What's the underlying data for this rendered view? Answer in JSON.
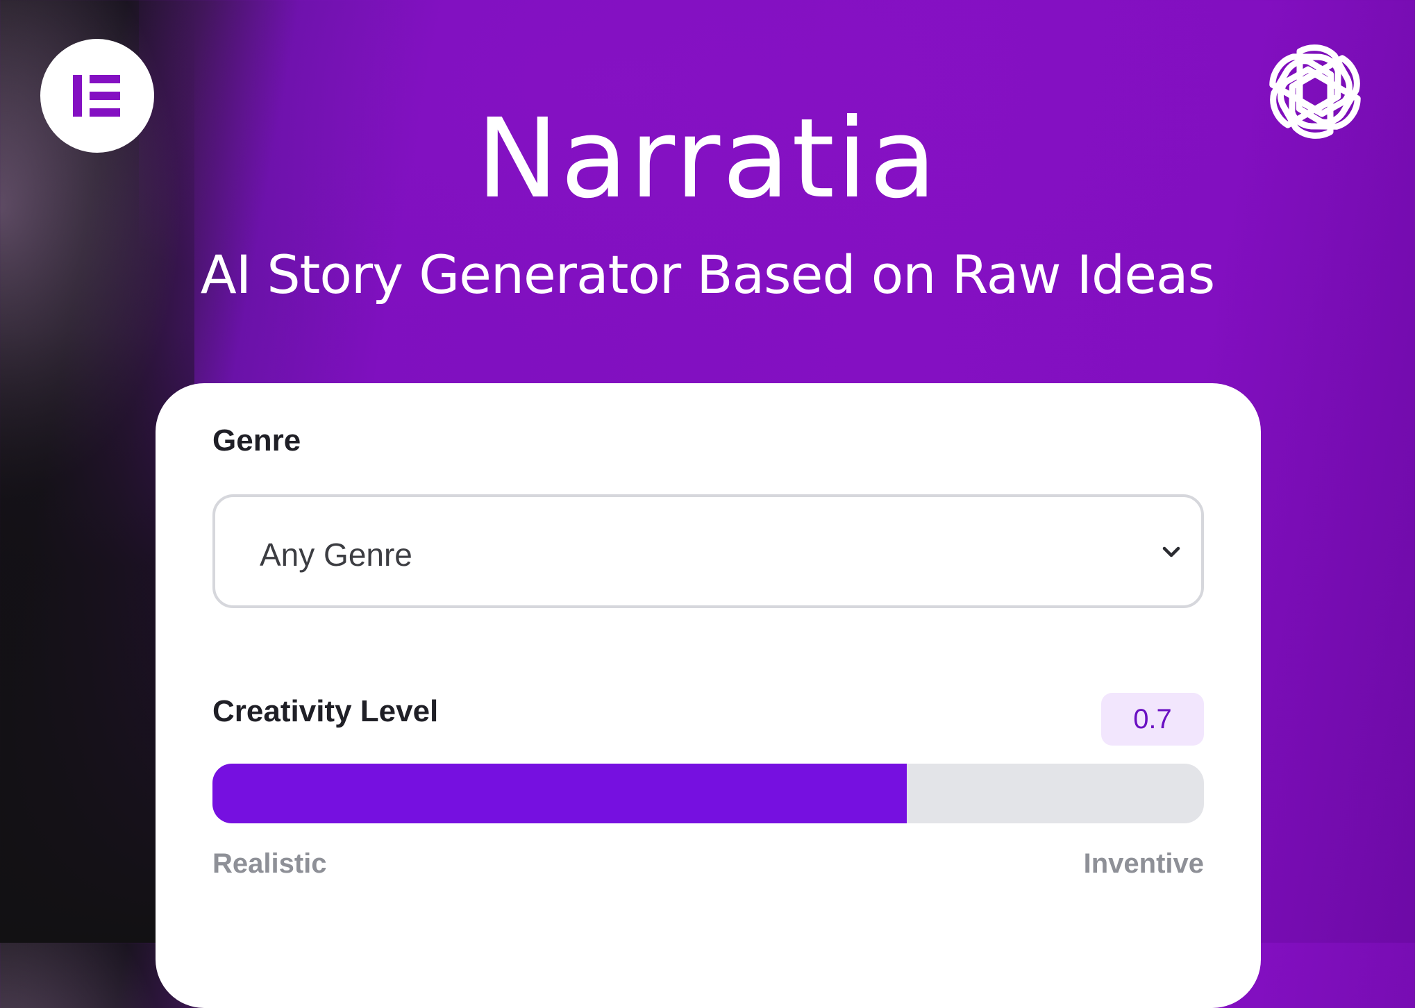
{
  "header": {
    "title": "Narratia",
    "subtitle": "AI Story Generator Based on Raw Ideas",
    "left_logo_icon": "elementor-logo-icon",
    "right_logo_icon": "openai-logo-icon"
  },
  "form": {
    "genre": {
      "label": "Genre",
      "selected": "Any Genre"
    },
    "creativity": {
      "label": "Creativity Level",
      "value_display": "0.7",
      "value": 0.7,
      "min_label": "Realistic",
      "max_label": "Inventive"
    }
  },
  "colors": {
    "brand_purple": "#8410c2",
    "slider_fill": "#7610e0",
    "badge_bg": "#f2e6fd",
    "badge_text": "#6a10c2"
  }
}
